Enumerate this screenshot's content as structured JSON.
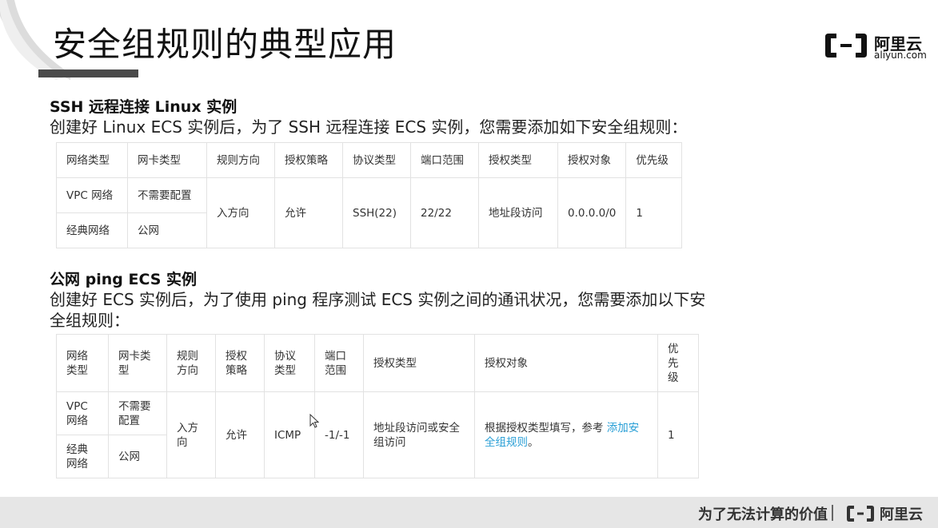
{
  "page": {
    "title": "安全组规则的典型应用"
  },
  "logo": {
    "cn": "阿里云",
    "en": "aliyun.com"
  },
  "section1": {
    "heading": "SSH 远程连接 Linux 实例",
    "desc": "创建好 Linux ECS 实例后，为了 SSH 远程连接 ECS 实例，您需要添加如下安全组规则：",
    "headers": [
      "网络类型",
      "网卡类型",
      "规则方向",
      "授权策略",
      "协议类型",
      "端口范围",
      "授权类型",
      "授权对象",
      "优先级"
    ],
    "rows": [
      {
        "network": "VPC 网络",
        "nic": "不需要配置"
      },
      {
        "network": "经典网络",
        "nic": "公网"
      }
    ],
    "shared": {
      "direction": "入方向",
      "policy": "允许",
      "protocol": "SSH(22)",
      "port": "22/22",
      "auth_type": "地址段访问",
      "auth_object": "0.0.0.0/0",
      "priority": "1"
    }
  },
  "section2": {
    "heading": "公网 ping ECS 实例",
    "desc": "创建好 ECS 实例后，为了使用 ping 程序测试 ECS 实例之间的通讯状况，您需要添加以下安全组规则：",
    "headers": [
      "网络类型",
      "网卡类型",
      "规则方向",
      "授权策略",
      "协议类型",
      "端口范围",
      "授权类型",
      "授权对象",
      "优先级"
    ],
    "rows": [
      {
        "network": "VPC 网络",
        "nic": "不需要配置"
      },
      {
        "network": "经典网络",
        "nic": "公网"
      }
    ],
    "shared": {
      "direction": "入方向",
      "policy": "允许",
      "protocol": "ICMP",
      "port": "-1/-1",
      "auth_type": "地址段访问或安全组访问",
      "auth_object_prefix": "根据授权类型填写，参考 ",
      "auth_object_link": "添加安全组规则",
      "auth_object_suffix": "。",
      "priority": "1"
    }
  },
  "footer": {
    "slogan": "为了无法计算的价值",
    "cn": "阿里云"
  },
  "colors": {
    "link": "#2a9fd6",
    "footer_bg": "#e6e6e6",
    "title_bar": "#4a4a4a"
  }
}
